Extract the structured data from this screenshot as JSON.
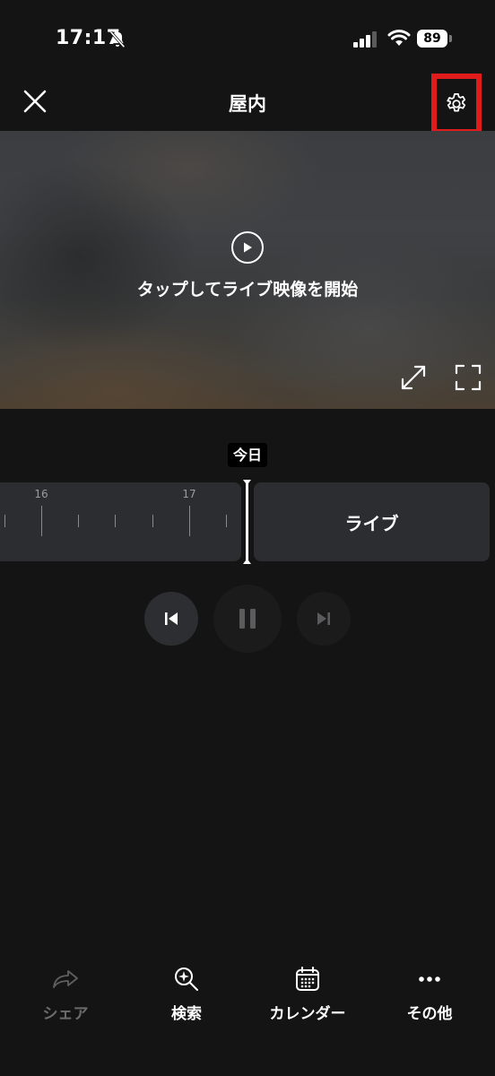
{
  "status_bar": {
    "time": "17:17",
    "battery": "89"
  },
  "header": {
    "title": "屋内"
  },
  "video": {
    "hint": "タップしてライブ映像を開始"
  },
  "timeline": {
    "today_label": "今日",
    "tick_labels": [
      "16",
      "17"
    ],
    "live_label": "ライブ"
  },
  "bottom_bar": {
    "items": [
      {
        "label": "シェア",
        "icon": "share-icon",
        "enabled": false
      },
      {
        "label": "検索",
        "icon": "search-sparkle-icon",
        "enabled": true
      },
      {
        "label": "カレンダー",
        "icon": "calendar-icon",
        "enabled": true
      },
      {
        "label": "その他",
        "icon": "more-icon",
        "enabled": true
      }
    ]
  },
  "colors": {
    "background": "#141414",
    "highlight_box": "#e01b1b",
    "segment": "#2c2d30",
    "disabled_text": "#6b6b6b"
  }
}
